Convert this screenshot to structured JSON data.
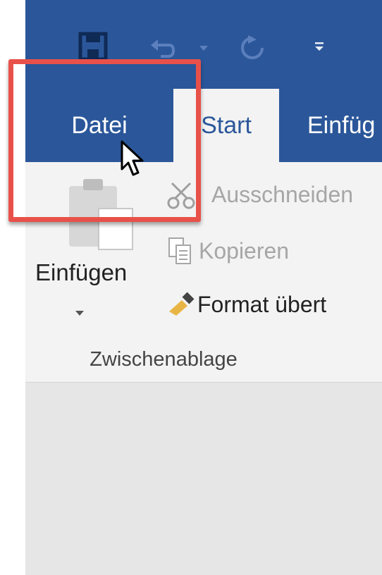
{
  "tabs": {
    "file": "Datei",
    "start": "Start",
    "insert": "Einfüg"
  },
  "quick_access": {
    "items": [
      "save-icon",
      "undo-icon",
      "redo-icon",
      "customize-qat-icon"
    ]
  },
  "clipboard": {
    "paste_label": "Einfügen",
    "cut_label": "Ausschneiden",
    "copy_label": "Kopieren",
    "format_painter_label": "Format übert",
    "group_label": "Zwischenablage"
  },
  "colors": {
    "accent": "#2b579a",
    "ribbon_bg": "#f3f3f3",
    "highlight": "#e8514a"
  }
}
